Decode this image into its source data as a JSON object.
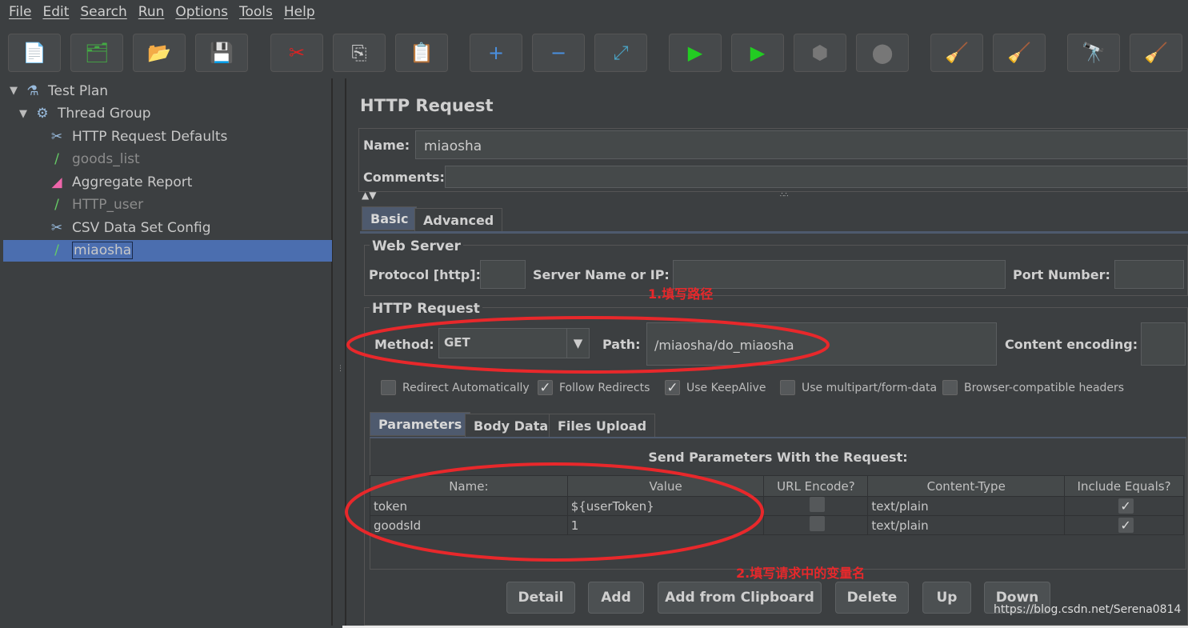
{
  "menu": [
    "File",
    "Edit",
    "Search",
    "Run",
    "Options",
    "Tools",
    "Help"
  ],
  "toolbar": [
    {
      "name": "new-icon",
      "glyph": "📄"
    },
    {
      "name": "templates-icon",
      "glyph": "🗂"
    },
    {
      "name": "open-icon",
      "glyph": "📂"
    },
    {
      "name": "save-icon",
      "glyph": "💾"
    },
    {
      "name": "cut-icon",
      "glyph": "✂"
    },
    {
      "name": "copy-icon",
      "glyph": "⎘"
    },
    {
      "name": "paste-icon",
      "glyph": "📋"
    },
    {
      "name": "expand-icon",
      "glyph": "+"
    },
    {
      "name": "collapse-icon",
      "glyph": "−"
    },
    {
      "name": "toggle-icon",
      "glyph": "⤢"
    },
    {
      "name": "start-icon",
      "glyph": "▶"
    },
    {
      "name": "start-no-pauses-icon",
      "glyph": "▶"
    },
    {
      "name": "stop-icon",
      "glyph": "⬢"
    },
    {
      "name": "shutdown-icon",
      "glyph": "⬤"
    },
    {
      "name": "clear-icon",
      "glyph": "🧹"
    },
    {
      "name": "clear-all-icon",
      "glyph": "🧹"
    },
    {
      "name": "search-binoculars-icon",
      "glyph": "🔭"
    },
    {
      "name": "reset-search-broom-icon",
      "glyph": "🧹"
    }
  ],
  "tree": [
    {
      "label": "Test Plan",
      "icon": "flask-icon",
      "glyph": "⚗",
      "indent": 0,
      "arrow": "▼",
      "disabled": false
    },
    {
      "label": "Thread Group",
      "icon": "gear-icon",
      "glyph": "⚙",
      "indent": 1,
      "arrow": "▼",
      "disabled": false
    },
    {
      "label": "HTTP Request Defaults",
      "icon": "tools-icon",
      "glyph": "✂",
      "indent": 2,
      "disabled": false
    },
    {
      "label": "goods_list",
      "icon": "pipette-icon",
      "glyph": "/",
      "indent": 2,
      "disabled": true
    },
    {
      "label": "Aggregate Report",
      "icon": "chart-icon",
      "glyph": "◢",
      "indent": 2,
      "disabled": false
    },
    {
      "label": "HTTP_user",
      "icon": "pipette-icon",
      "glyph": "/",
      "indent": 2,
      "disabled": true
    },
    {
      "label": "CSV Data Set Config",
      "icon": "tools-icon",
      "glyph": "✂",
      "indent": 2,
      "disabled": false
    },
    {
      "label": "miaosha",
      "icon": "pipette-icon",
      "glyph": "/",
      "indent": 2,
      "disabled": false,
      "selected": true
    }
  ],
  "panel": {
    "title": "HTTP Request",
    "name_label": "Name:",
    "name_value": "miaosha",
    "comments_label": "Comments:",
    "comments_value": "",
    "tabs": [
      "Basic",
      "Advanced"
    ],
    "web_server": {
      "legend": "Web Server",
      "protocol_label": "Protocol [http]:",
      "protocol_value": "",
      "server_label": "Server Name or IP:",
      "server_value": "",
      "port_label": "Port Number:",
      "port_value": ""
    },
    "http_request": {
      "legend": "HTTP Request",
      "method_label": "Method:",
      "method_value": "GET",
      "path_label": "Path:",
      "path_value": "/miaosha/do_miaosha",
      "encoding_label": "Content encoding:",
      "encoding_value": ""
    },
    "checkboxes": [
      {
        "label": "Redirect Automatically",
        "checked": false
      },
      {
        "label": "Follow Redirects",
        "checked": true
      },
      {
        "label": "Use KeepAlive",
        "checked": true
      },
      {
        "label": "Use multipart/form-data",
        "checked": false
      },
      {
        "label": "Browser-compatible headers",
        "checked": false
      }
    ],
    "subtabs": [
      "Parameters",
      "Body Data",
      "Files Upload"
    ],
    "params_title": "Send Parameters With the Request:",
    "columns": [
      "Name:",
      "Value",
      "URL Encode?",
      "Content-Type",
      "Include Equals?"
    ],
    "rows": [
      {
        "name": "token",
        "value": "${userToken}",
        "url_encode": false,
        "content_type": "text/plain",
        "include_equals": true
      },
      {
        "name": "goodsId",
        "value": "1",
        "url_encode": false,
        "content_type": "text/plain",
        "include_equals": true
      }
    ],
    "buttons": [
      "Detail",
      "Add",
      "Add from Clipboard",
      "Delete",
      "Up",
      "Down"
    ]
  },
  "annotations": {
    "a1": "1.填写路径",
    "a2": "2.填写请求中的变量名",
    "color": "#e8282b"
  },
  "watermark": "https://blog.csdn.net/Serena0814"
}
